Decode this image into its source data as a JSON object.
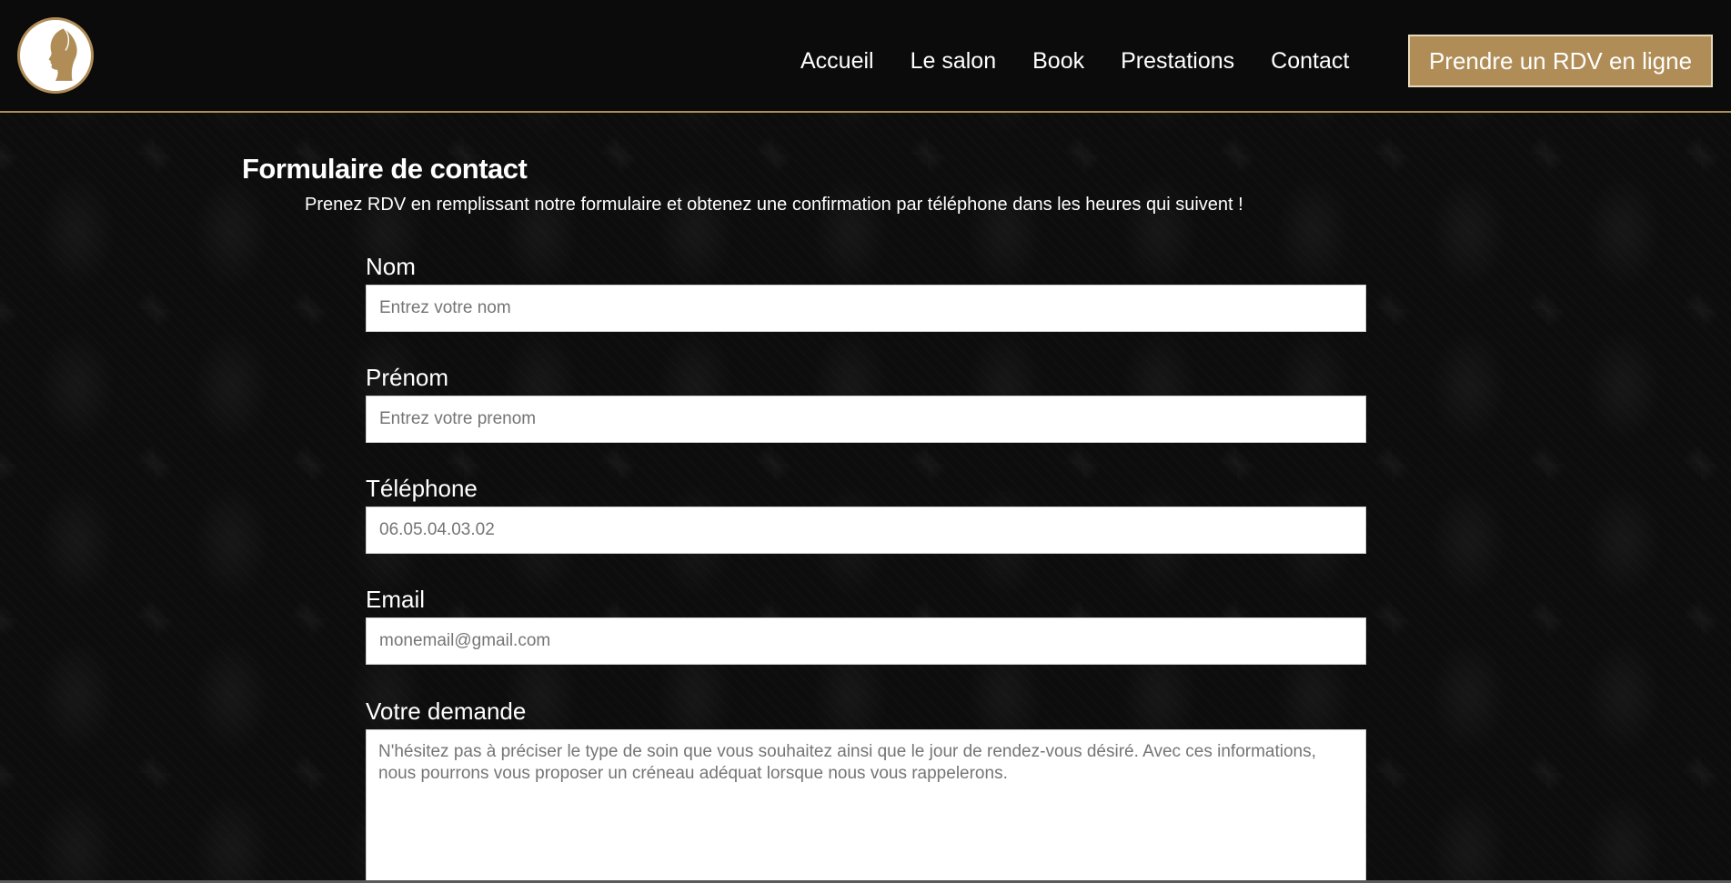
{
  "header": {
    "logo_name": "woman-profile-logo",
    "nav": [
      {
        "label": "Accueil"
      },
      {
        "label": "Le salon"
      },
      {
        "label": "Book"
      },
      {
        "label": "Prestations"
      },
      {
        "label": "Contact"
      }
    ],
    "cta_label": "Prendre un RDV en ligne"
  },
  "form": {
    "title": "Formulaire de contact",
    "subtitle": "Prenez RDV en remplissant notre formulaire et obtenez une confirmation par téléphone dans les heures qui suivent !",
    "fields": {
      "nom": {
        "label": "Nom",
        "placeholder": "Entrez votre nom"
      },
      "prenom": {
        "label": "Prénom",
        "placeholder": "Entrez votre prenom"
      },
      "telephone": {
        "label": "Téléphone",
        "placeholder": "06.05.04.03.02"
      },
      "email": {
        "label": "Email",
        "placeholder": "monemail@gmail.com"
      },
      "demande": {
        "label": "Votre demande",
        "placeholder": "N'hésitez pas à préciser le type de soin que vous souhaitez ainsi que le jour de rendez-vous désiré. Avec ces informations, nous pourrons vous proposer un créneau adéquat lorsque nous vous rappelerons."
      }
    }
  },
  "colors": {
    "accent": "#b08d57",
    "background": "#0b0b0b",
    "text": "#ffffff"
  }
}
